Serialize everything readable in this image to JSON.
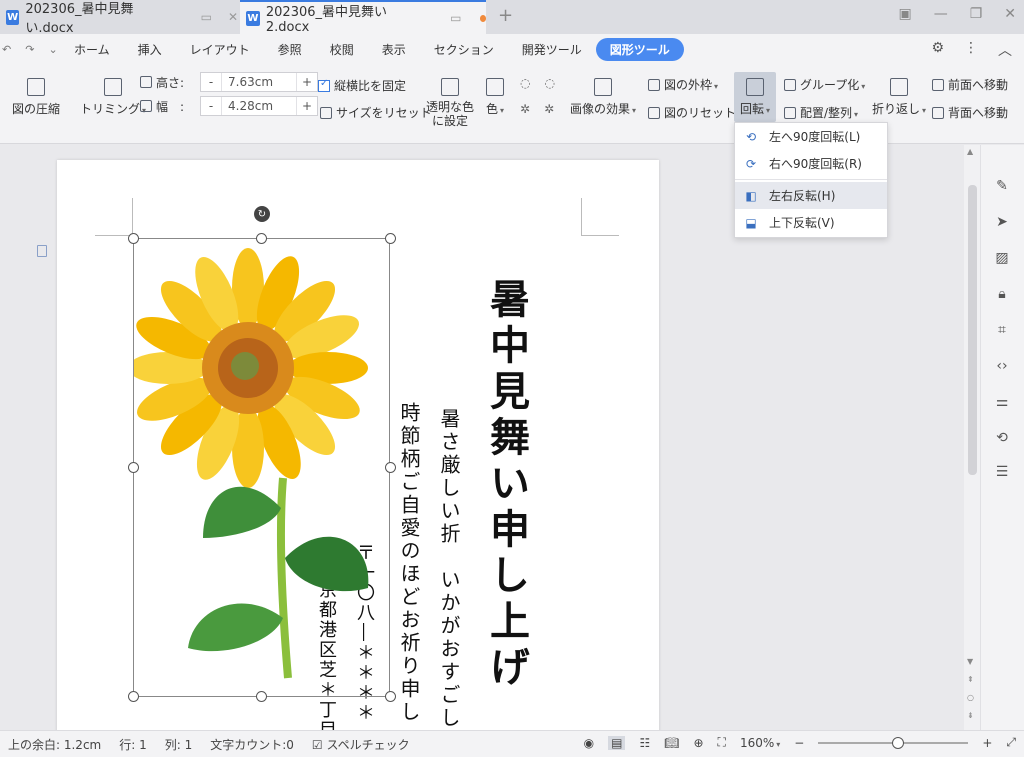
{
  "tabs": [
    {
      "title": "202306_暑中見舞い.docx",
      "logo": "W"
    },
    {
      "title": "202306_暑中見舞い2.docx",
      "logo": "W"
    }
  ],
  "menu": {
    "items": [
      "ホーム",
      "挿入",
      "レイアウト",
      "参照",
      "校閲",
      "表示",
      "セクション",
      "開発ツール",
      "図形ツール"
    ]
  },
  "ribbon": {
    "compress": "図の圧縮",
    "trim": "トリミング",
    "height_label": "高さ:",
    "height_value": "7.63cm",
    "width_label": "幅　:",
    "width_value": "4.28cm",
    "lock_ratio": "縦横比を固定",
    "reset_size": "サイズをリセット",
    "transparent_line1": "透明な色",
    "transparent_line2": "に設定",
    "color": "色",
    "image_effect": "画像の効果",
    "outline": "図の外枠",
    "reset_image": "図のリセット",
    "rotate": "回転",
    "group": "グループ化",
    "align": "配置/整列",
    "wrap": "折り返し",
    "bring_forward": "前面へ移動",
    "send_backward": "背面へ移動"
  },
  "rotate_menu": {
    "items": [
      "左へ90度回転(L)",
      "右へ90度回転(R)",
      "左右反転(H)",
      "上下反転(V)"
    ]
  },
  "document": {
    "title_vertical": "暑中見舞い申し上げ",
    "line1": "暑さ厳しい折　いかがおすごし",
    "line2": "時節柄ご自愛のほどお祈り申し",
    "addr1": "〒一〇八―＊＊＊＊",
    "addr2": "東京都港区芝＊丁目＊"
  },
  "status": {
    "margin": "上の余白: 1.2cm",
    "row": "行: 1",
    "col": "列: 1",
    "word_count": "文字カウント:0",
    "spell_check": "スペルチェック",
    "zoom": "160%"
  },
  "colors": {
    "accent": "#3a7be0",
    "active_tool_tab": "#4a8af0"
  }
}
